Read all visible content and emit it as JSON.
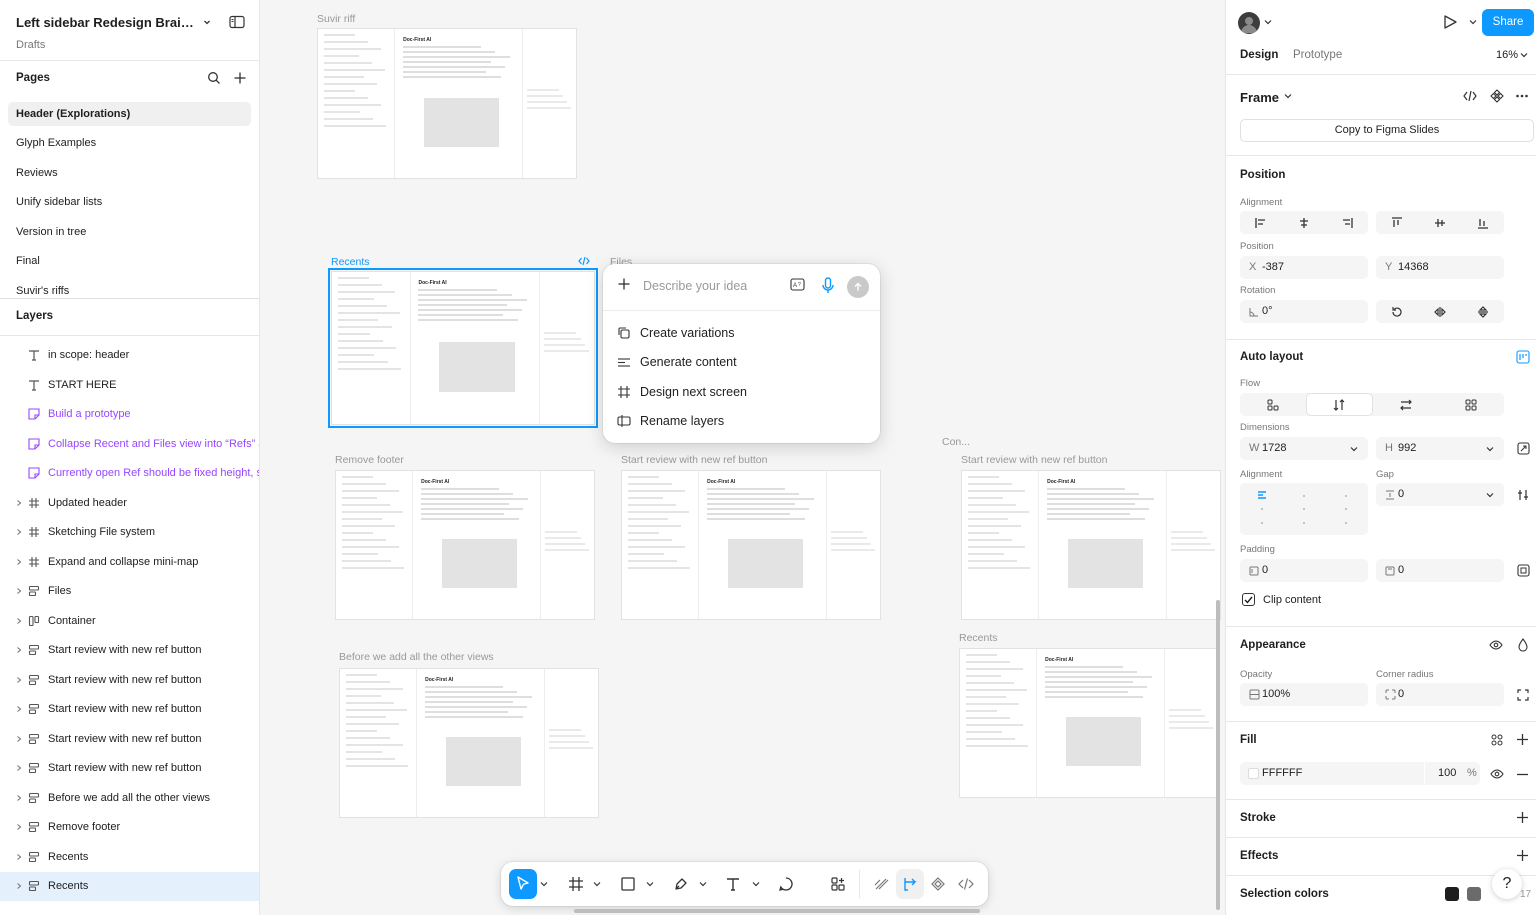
{
  "file": {
    "title": "Left sidebar Redesign Brains...",
    "location": "Drafts"
  },
  "pages": {
    "title": "Pages",
    "items": [
      {
        "label": "Header (Explorations)",
        "selected": true
      },
      {
        "label": "Glyph Examples"
      },
      {
        "label": "Reviews"
      },
      {
        "label": "Unify sidebar lists"
      },
      {
        "label": "Version in tree"
      },
      {
        "label": "Final"
      },
      {
        "label": "Suvir's riffs"
      }
    ]
  },
  "layers": {
    "title": "Layers",
    "items": [
      {
        "label": "in scope: header",
        "icon": "text-icon"
      },
      {
        "label": "START HERE",
        "icon": "text-icon"
      },
      {
        "label": "Build a prototype",
        "icon": "sticky-note-icon",
        "color": "purple"
      },
      {
        "label": "Collapse Recent and Files view into “Refs” a",
        "icon": "sticky-note-icon",
        "color": "purple"
      },
      {
        "label": "Currently open Ref should be fixed height, s",
        "icon": "sticky-note-icon",
        "color": "purple"
      },
      {
        "label": "Updated header",
        "icon": "frame-icon"
      },
      {
        "label": "Sketching File system",
        "icon": "frame-icon"
      },
      {
        "label": "Expand and collapse mini-map",
        "icon": "frame-icon"
      },
      {
        "label": "Files",
        "icon": "autolayout-vertical-icon"
      },
      {
        "label": "Container",
        "icon": "autolayout-horizontal-icon"
      },
      {
        "label": "Start review with new ref button",
        "icon": "autolayout-vertical-icon"
      },
      {
        "label": "Start review with new ref button",
        "icon": "autolayout-vertical-icon"
      },
      {
        "label": "Start review with new ref button",
        "icon": "autolayout-vertical-icon"
      },
      {
        "label": "Start review with new ref button",
        "icon": "autolayout-vertical-icon"
      },
      {
        "label": "Start review with new ref button",
        "icon": "autolayout-vertical-icon"
      },
      {
        "label": "Before we add all the other views",
        "icon": "autolayout-vertical-icon"
      },
      {
        "label": "Remove footer",
        "icon": "autolayout-vertical-icon"
      },
      {
        "label": "Recents",
        "icon": "autolayout-vertical-icon"
      },
      {
        "label": "Recents",
        "icon": "autolayout-vertical-icon",
        "selected": true
      }
    ]
  },
  "canvas": {
    "frames": [
      {
        "label": "Suvir riff",
        "thumb_title": "Doc-First AI"
      },
      {
        "label": "Recents",
        "thumb_title": "Doc-First AI",
        "selected": true
      },
      {
        "label": "Files"
      },
      {
        "label": "Remove footer",
        "thumb_title": "Doc-First AI"
      },
      {
        "label": "Start review with new ref button",
        "thumb_title": "Doc-First AI"
      },
      {
        "label": "Con..."
      },
      {
        "label": "Start review with new ref button",
        "thumb_title": "Doc-First AI"
      },
      {
        "label": "Before we add all the other views",
        "thumb_title": "Doc-First AI"
      },
      {
        "label": "Recents",
        "thumb_title": "Doc-First AI"
      }
    ],
    "ai_prompt": {
      "placeholder": "Describe your idea",
      "options": [
        "Create variations",
        "Generate content",
        "Design next screen",
        "Rename layers"
      ]
    }
  },
  "toolbar": {
    "tools": [
      "move-tool",
      "frame-tool",
      "shape-tool",
      "pen-tool",
      "text-tool",
      "comment-tool",
      "actions-tool"
    ],
    "modes": [
      "draw-mode",
      "design-mode",
      "dev-components-mode",
      "dev-mode"
    ],
    "active_tool": "move-tool",
    "active_mode": "design-mode"
  },
  "header": {
    "share_label": "Share",
    "zoom": "16%"
  },
  "tabs": {
    "design": "Design",
    "prototype": "Prototype"
  },
  "properties": {
    "frame_title": "Frame",
    "copy_slides": "Copy to Figma Slides",
    "position": {
      "title": "Position",
      "alignment_label": "Alignment",
      "position_label": "Position",
      "x_label": "X",
      "x": "-387",
      "y_label": "Y",
      "y": "14368",
      "rotation_label": "Rotation",
      "rotation": "0°"
    },
    "auto_layout": {
      "title": "Auto layout",
      "flow_label": "Flow",
      "dimensions_label": "Dimensions",
      "w_label": "W",
      "w": "1728",
      "h_label": "H",
      "h": "992",
      "alignment_label": "Alignment",
      "gap_label": "Gap",
      "gap": "0",
      "padding_label": "Padding",
      "padding_h": "0",
      "padding_v": "0",
      "clip_label": "Clip content",
      "clip": true
    },
    "appearance": {
      "title": "Appearance",
      "opacity_label": "Opacity",
      "opacity": "100%",
      "radius_label": "Corner radius",
      "radius": "0"
    },
    "fill": {
      "title": "Fill",
      "hex": "FFFFFF",
      "opacity": "100",
      "unit": "%"
    },
    "stroke": {
      "title": "Stroke"
    },
    "effects": {
      "title": "Effects"
    },
    "selection_colors": {
      "title": "Selection colors",
      "count": "17",
      "colors": [
        "#1e1e1e",
        "#6b6b6b"
      ]
    }
  },
  "help": "?",
  "colors": {
    "accent": "#0d99ff",
    "purple": "#9747ff",
    "selection_bg": "#e5f0fd"
  }
}
